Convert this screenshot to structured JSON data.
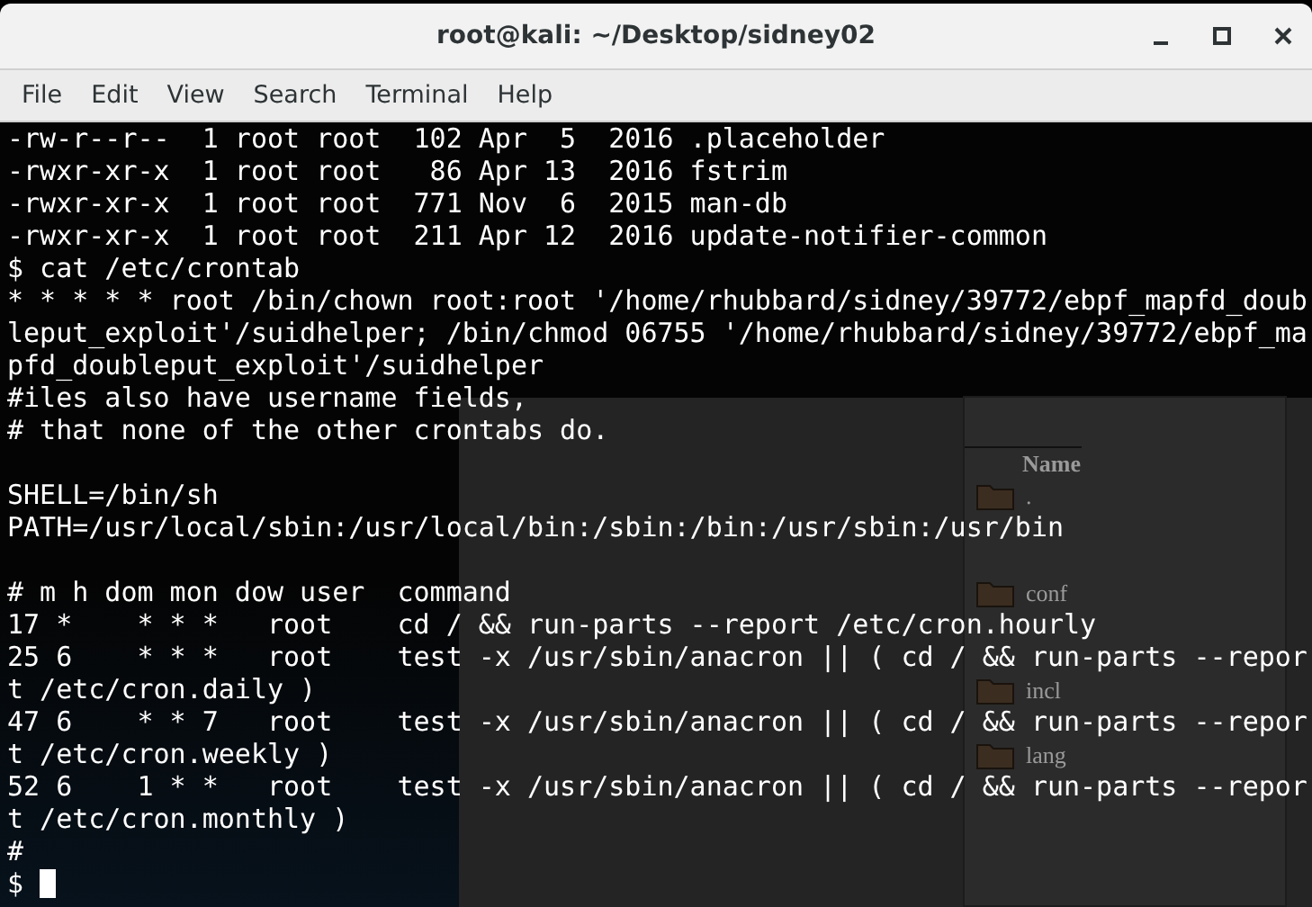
{
  "window": {
    "title": "root@kali: ~/Desktop/sidney02"
  },
  "menu": [
    "File",
    "Edit",
    "View",
    "Search",
    "Terminal",
    "Help"
  ],
  "background_window": {
    "column_header": "Name",
    "items": [
      ".",
      "conf",
      "incl",
      "lang"
    ]
  },
  "terminal": {
    "lines": [
      {
        "kind": "text",
        "text": "-rw-r--r--  1 root root  102 Apr  5  2016 .placeholder"
      },
      {
        "kind": "text",
        "text": "-rwxr-xr-x  1 root root   86 Apr 13  2016 fstrim"
      },
      {
        "kind": "text",
        "text": "-rwxr-xr-x  1 root root  771 Nov  6  2015 man-db"
      },
      {
        "kind": "text",
        "text": "-rwxr-xr-x  1 root root  211 Apr 12  2016 update-notifier-common"
      },
      {
        "kind": "text",
        "text": "$ cat /etc/crontab"
      },
      {
        "kind": "text",
        "text": "* * * * * root /bin/chown root:root '/home/rhubbard/sidney/39772/ebpf_mapfd_doub"
      },
      {
        "kind": "text",
        "text": "leput_exploit'/suidhelper; /bin/chmod 06755 '/home/rhubbard/sidney/39772/ebpf_ma"
      },
      {
        "kind": "text",
        "text": "pfd_doubleput_exploit'/suidhelper"
      },
      {
        "kind": "text",
        "text": "#iles also have username fields,"
      },
      {
        "kind": "text",
        "text": "# that none of the other crontabs do."
      },
      {
        "kind": "blank"
      },
      {
        "kind": "text",
        "text": "SHELL=/bin/sh"
      },
      {
        "kind": "text",
        "text": "PATH=/usr/local/sbin:/usr/local/bin:/sbin:/bin:/usr/sbin:/usr/bin"
      },
      {
        "kind": "blank"
      },
      {
        "kind": "text",
        "text": "# m h dom mon dow user  command"
      },
      {
        "kind": "text",
        "text": "17 *    * * *   root    cd / && run-parts --report /etc/cron.hourly"
      },
      {
        "kind": "text",
        "text": "25 6    * * *   root    test -x /usr/sbin/anacron || ( cd / && run-parts --repor"
      },
      {
        "kind": "text",
        "text": "t /etc/cron.daily )"
      },
      {
        "kind": "text",
        "text": "47 6    * * 7   root    test -x /usr/sbin/anacron || ( cd / && run-parts --repor"
      },
      {
        "kind": "text",
        "text": "t /etc/cron.weekly )"
      },
      {
        "kind": "text",
        "text": "52 6    1 * *   root    test -x /usr/sbin/anacron || ( cd / && run-parts --repor"
      },
      {
        "kind": "text",
        "text": "t /etc/cron.monthly )"
      },
      {
        "kind": "text",
        "text": "#"
      }
    ],
    "prompt": "$"
  }
}
